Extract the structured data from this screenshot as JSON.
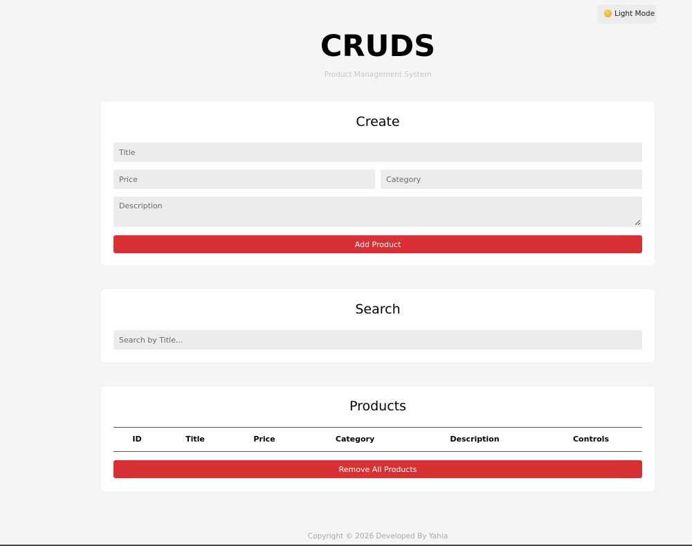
{
  "theme": {
    "toggle_label": "Light Mode",
    "toggle_icon": "sun-icon"
  },
  "header": {
    "title": "CRUDS",
    "subtitle": "Product Management System"
  },
  "create": {
    "heading": "Create",
    "title_placeholder": "Title",
    "price_placeholder": "Price",
    "category_placeholder": "Category",
    "description_placeholder": "Description",
    "submit_label": "Add Product"
  },
  "search": {
    "heading": "Search",
    "placeholder": "Search by Title..."
  },
  "products": {
    "heading": "Products",
    "columns": [
      "ID",
      "Title",
      "Price",
      "Category",
      "Description",
      "Controls"
    ],
    "rows": [],
    "remove_all_label": "Remove All Products"
  },
  "footer": {
    "text": "Copyright © 2026 Developed By Yahia"
  },
  "colors": {
    "accent": "#d93035",
    "background": "#f5f5f5",
    "field": "#ececec"
  }
}
